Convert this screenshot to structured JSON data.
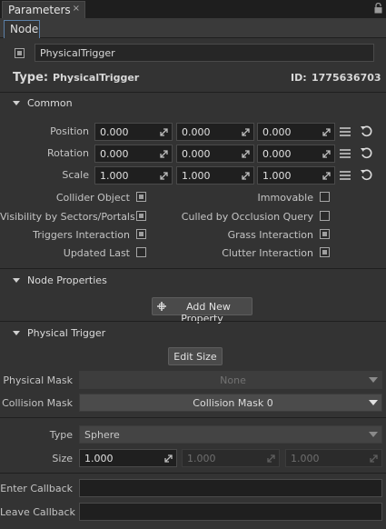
{
  "window": {
    "title": "Parameters",
    "close_glyph": "×"
  },
  "tabs": {
    "active": "Node"
  },
  "node": {
    "enabled": true,
    "name": "PhysicalTrigger",
    "type_label": "Type:",
    "type_value": "PhysicalTrigger",
    "id_label": "ID:",
    "id_value": "1775636703"
  },
  "common": {
    "title": "Common",
    "rows": [
      {
        "label": "Position",
        "x": "0.000",
        "y": "0.000",
        "z": "0.000"
      },
      {
        "label": "Rotation",
        "x": "0.000",
        "y": "0.000",
        "z": "0.000"
      },
      {
        "label": "Scale",
        "x": "1.000",
        "y": "1.000",
        "z": "1.000"
      }
    ],
    "flags": [
      {
        "label": "Collider Object",
        "checked": true
      },
      {
        "label": "Immovable",
        "checked": false
      },
      {
        "label": "Visibility by Sectors/Portals",
        "checked": true
      },
      {
        "label": "Culled by Occlusion Query",
        "checked": false
      },
      {
        "label": "Triggers Interaction",
        "checked": true
      },
      {
        "label": "Grass Interaction",
        "checked": true
      },
      {
        "label": "Updated Last",
        "checked": false
      },
      {
        "label": "Clutter Interaction",
        "checked": true
      }
    ]
  },
  "node_properties": {
    "title": "Node Properties",
    "add_button": "Add New Property"
  },
  "physical_trigger": {
    "title": "Physical Trigger",
    "edit_size_button": "Edit Size",
    "physical_mask_label": "Physical Mask",
    "physical_mask_value": "None",
    "collision_mask_label": "Collision Mask",
    "collision_mask_value": "Collision Mask 0",
    "type_label": "Type",
    "type_value": "Sphere",
    "size_label": "Size",
    "size_values": [
      "1.000",
      "1.000",
      "1.000"
    ],
    "enter_callback_label": "Enter Callback",
    "enter_callback_value": "",
    "leave_callback_label": "Leave Callback",
    "leave_callback_value": ""
  },
  "icons": {
    "lock": "lock-icon",
    "menu": "menu-icon",
    "reset": "reset-icon",
    "spin": "spin-arrow-icon",
    "plus": "plus-icon",
    "collapse": "collapse-triangle-icon"
  },
  "colors": {
    "background": "#333333",
    "field": "#1f1f1f",
    "tab_accent": "#5b7fa6"
  }
}
